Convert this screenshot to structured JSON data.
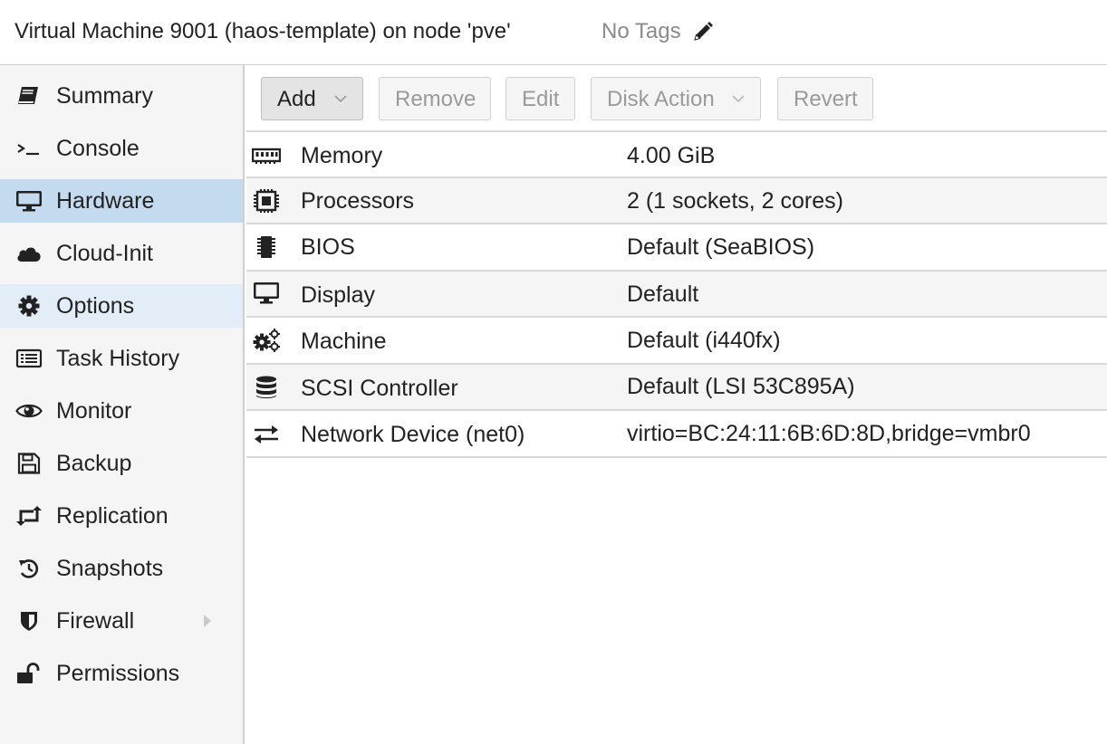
{
  "header": {
    "title": "Virtual Machine 9001 (haos-template) on node 'pve'",
    "tags_label": "No Tags",
    "tags_edit_icon": "pencil-icon"
  },
  "sidebar": {
    "items": [
      {
        "label": "Summary",
        "icon": "book-icon",
        "state": "normal"
      },
      {
        "label": "Console",
        "icon": "terminal-icon",
        "state": "normal"
      },
      {
        "label": "Hardware",
        "icon": "desktop-icon",
        "state": "selected"
      },
      {
        "label": "Cloud-Init",
        "icon": "cloud-icon",
        "state": "normal"
      },
      {
        "label": "Options",
        "icon": "gear-icon",
        "state": "hover"
      },
      {
        "label": "Task History",
        "icon": "list-icon",
        "state": "normal"
      },
      {
        "label": "Monitor",
        "icon": "eye-icon",
        "state": "normal"
      },
      {
        "label": "Backup",
        "icon": "floppy-icon",
        "state": "normal"
      },
      {
        "label": "Replication",
        "icon": "retweet-icon",
        "state": "normal"
      },
      {
        "label": "Snapshots",
        "icon": "history-icon",
        "state": "normal"
      },
      {
        "label": "Firewall",
        "icon": "shield-icon",
        "state": "normal",
        "expandable": true
      },
      {
        "label": "Permissions",
        "icon": "unlock-icon",
        "state": "normal"
      }
    ]
  },
  "toolbar": {
    "add_label": "Add",
    "remove_label": "Remove",
    "edit_label": "Edit",
    "disk_action_label": "Disk Action",
    "revert_label": "Revert"
  },
  "hardware": {
    "rows": [
      {
        "name": "Memory",
        "value": "4.00 GiB",
        "icon": "memory-icon"
      },
      {
        "name": "Processors",
        "value": "2 (1 sockets, 2 cores)",
        "icon": "cpu-icon"
      },
      {
        "name": "BIOS",
        "value": "Default (SeaBIOS)",
        "icon": "microchip-icon"
      },
      {
        "name": "Display",
        "value": "Default",
        "icon": "desktop-icon"
      },
      {
        "name": "Machine",
        "value": "Default (i440fx)",
        "icon": "gears-icon"
      },
      {
        "name": "SCSI Controller",
        "value": "Default (LSI 53C895A)",
        "icon": "database-icon"
      },
      {
        "name": "Network Device (net0)",
        "value": "virtio=BC:24:11:6B:6D:8D,bridge=vmbr0",
        "icon": "exchange-icon"
      }
    ]
  },
  "colors": {
    "selected_bg": "#c4daee",
    "hover_bg": "#e2edf7",
    "sidebar_bg": "#f5f5f5",
    "alt_row_bg": "#f5f5f5"
  }
}
